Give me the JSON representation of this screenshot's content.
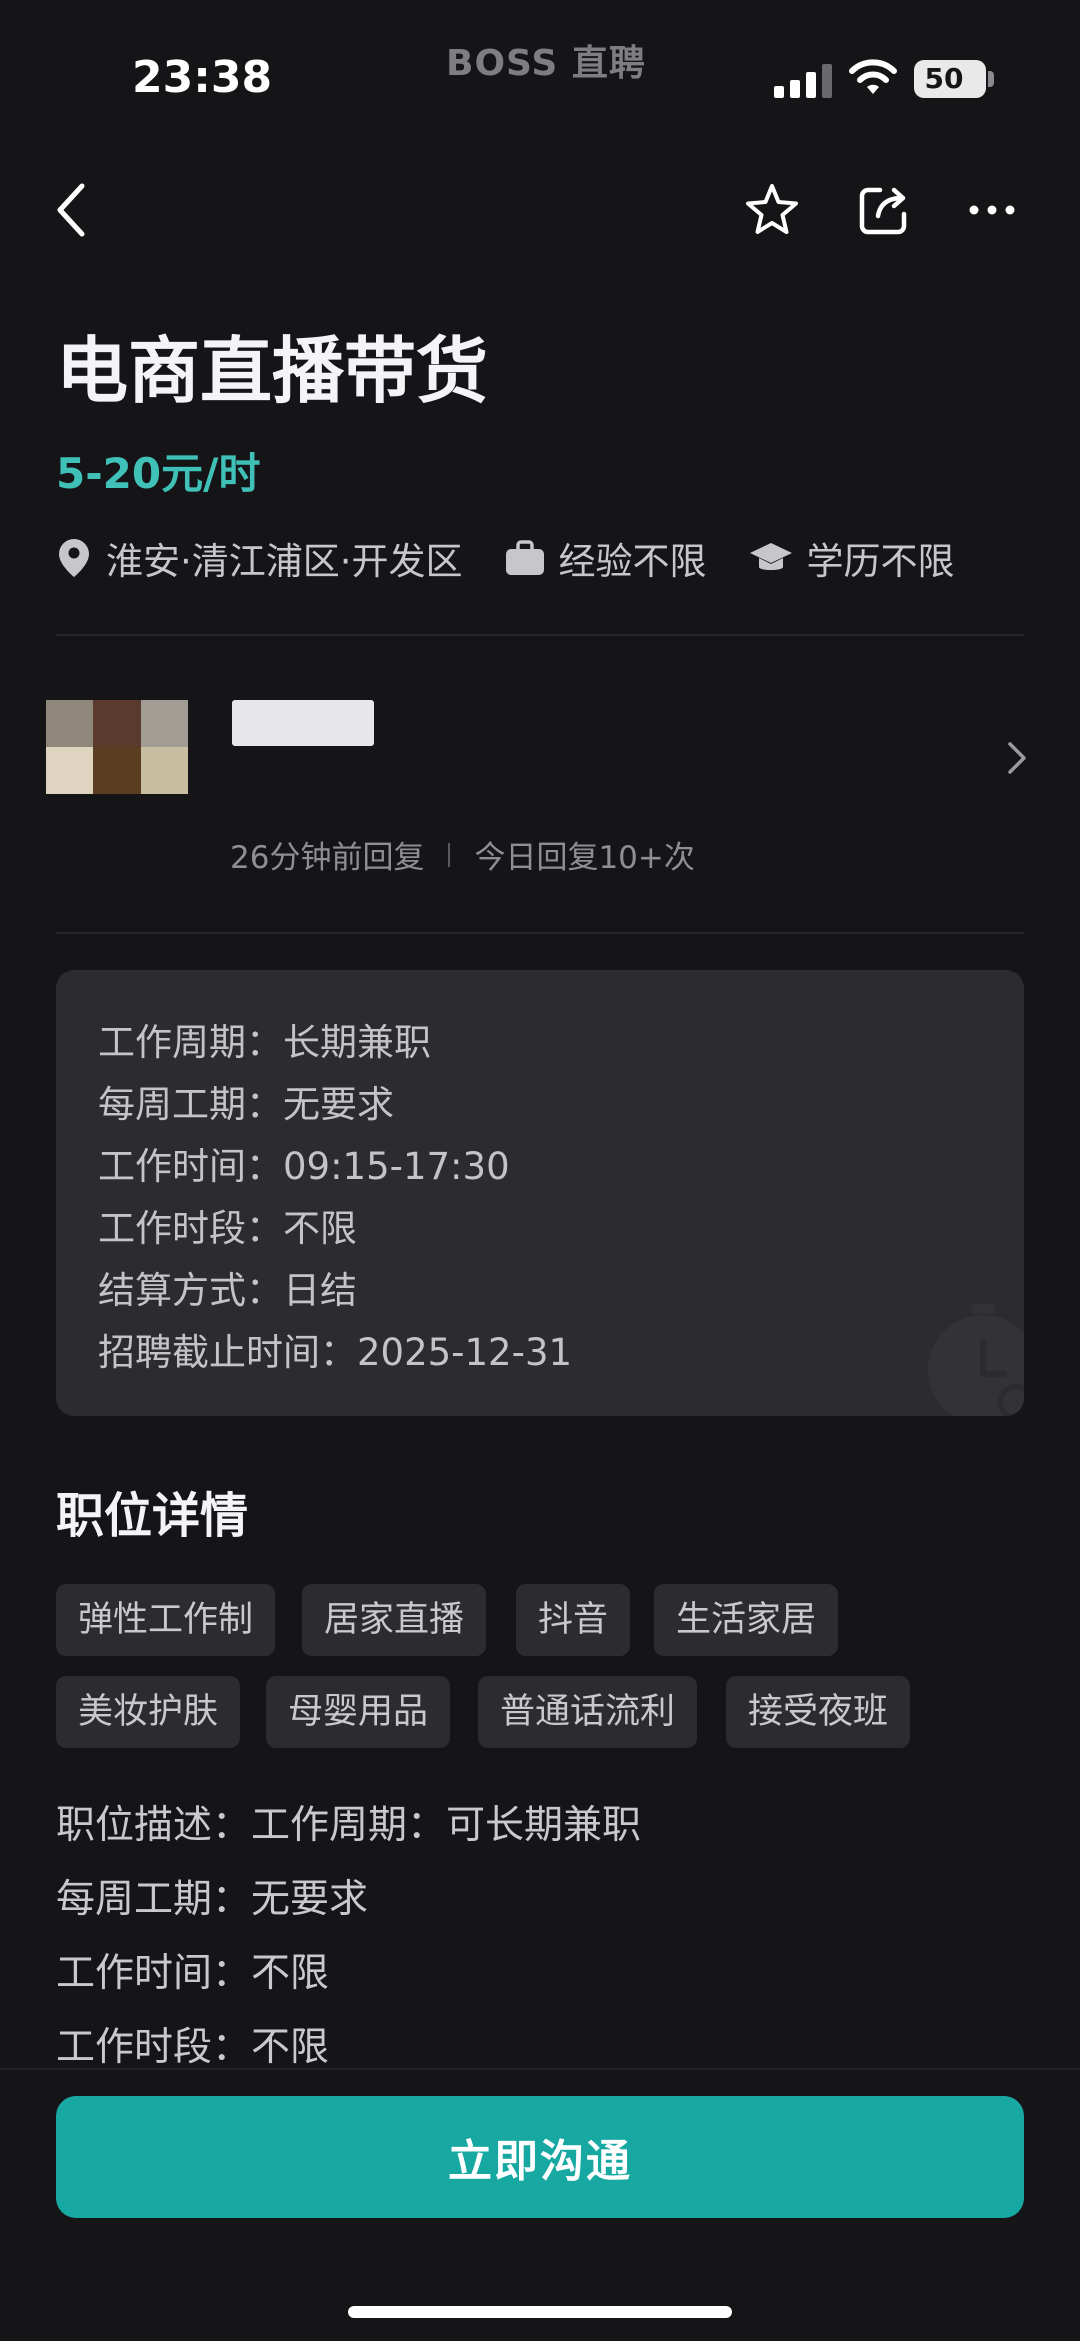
{
  "status_bar": {
    "time": "23:38",
    "app_name": "BOSS 直聘",
    "battery": "50"
  },
  "nav": {
    "back_icon": "chevron-left-icon",
    "favorite_icon": "star-icon",
    "share_icon": "share-icon",
    "more_icon": "more-dots-icon"
  },
  "job": {
    "title": "电商直播带货",
    "salary": "5-20元/时",
    "location": "淮安·清江浦区·开发区",
    "experience": "经验不限",
    "education": "学历不限"
  },
  "recruiter": {
    "reply_time": "26分钟前回复",
    "reply_count": "今日回复10+次"
  },
  "info_card": {
    "rows": [
      "工作周期：长期兼职",
      "每周工期：无要求",
      "工作时间：09:15-17:30",
      "工作时段：不限",
      "结算方式：日结",
      "招聘截止时间：2025-12-31"
    ]
  },
  "details": {
    "title": "职位详情",
    "tags": [
      "弹性工作制",
      "居家直播",
      "抖音",
      "生活家居",
      "美妆护肤",
      "母婴用品",
      "普通话流利",
      "接受夜班"
    ],
    "description": [
      "职位描述：工作周期：可长期兼职",
      "每周工期：无要求",
      "工作时间：不限",
      "工作时段：不限"
    ]
  },
  "cta": {
    "label": "立即沟通"
  },
  "colors": {
    "background": "#151518",
    "accent": "#17a8a2",
    "salary": "#3fc1b8",
    "card": "#2b2b30"
  }
}
